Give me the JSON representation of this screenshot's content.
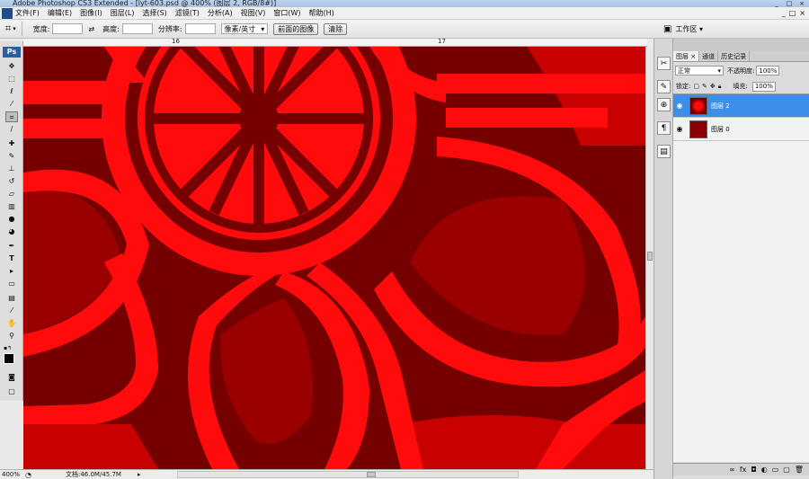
{
  "window": {
    "title": "Adobe Photoshop CS3 Extended - [lyt-603.psd @ 400% (图层 2, RGB/8#)]",
    "buttons": [
      "_",
      "□",
      "×"
    ]
  },
  "menu": [
    "文件(F)",
    "编辑(E)",
    "图像(I)",
    "图层(L)",
    "选择(S)",
    "滤镜(T)",
    "分析(A)",
    "视图(V)",
    "窗口(W)",
    "帮助(H)"
  ],
  "menu_window_buttons": [
    "_",
    "□",
    "×"
  ],
  "options": {
    "width_label": "宽度:",
    "height_label": "高度:",
    "resolution_label": "分辨率:",
    "unit_select": "像素/英寸",
    "front_image_button": "前面的图像",
    "clear_button": "清除",
    "workspace_label": "工作区 ▾"
  },
  "ruler": {
    "marks": [
      "16",
      "17"
    ]
  },
  "tools": [
    "Ps",
    "move",
    "marquee",
    "lasso",
    "magic-wand",
    "crop",
    "slice",
    "healing",
    "brush",
    "stamp",
    "history-brush",
    "eraser",
    "gradient",
    "blur",
    "dodge",
    "pen",
    "T",
    "path-select",
    "shape",
    "notes",
    "eyedropper",
    "hand",
    "zoom"
  ],
  "status": {
    "zoom": "400%",
    "doc": "文档:46.0M/45.7M"
  },
  "layers_panel": {
    "tabs": [
      "图层 ×",
      "通道",
      "历史记录"
    ],
    "blend_mode": "正常",
    "opacity_label": "不透明度:",
    "opacity_value": "100%",
    "lock_label": "锁定:",
    "fill_label": "填充:",
    "fill_value": "100%",
    "layers": [
      {
        "name": "图层 2",
        "selected": true
      },
      {
        "name": "图层 0",
        "selected": false
      }
    ],
    "footer_icons": [
      "link-icon",
      "fx-icon",
      "mask-icon",
      "adjustment-icon",
      "group-icon",
      "new-layer-icon",
      "trash-icon"
    ]
  },
  "colors": {
    "bg_dark": "#740000",
    "bright_red": "#ff0b0b",
    "mid_red": "#c80000",
    "selection_blue": "#3d8ee9"
  }
}
